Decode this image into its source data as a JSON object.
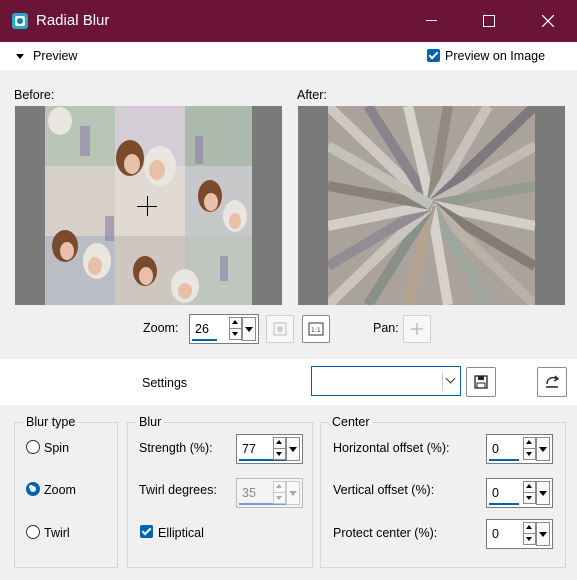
{
  "window": {
    "title": "Radial Blur",
    "icon": "psp-filter-icon",
    "controls": [
      "minimize-icon",
      "maximize-icon",
      "close-icon"
    ],
    "accent_color": "#6b1436"
  },
  "preview": {
    "section_label": "Preview",
    "preview_on_image_label": "Preview on Image",
    "preview_on_image_checked": true,
    "before_label": "Before:",
    "after_label": "After:"
  },
  "zoom": {
    "label": "Zoom:",
    "value": "26",
    "pan_label": "Pan:"
  },
  "settings": {
    "label": "Settings",
    "preset_value": ""
  },
  "blur_type": {
    "title": "Blur type",
    "options": [
      {
        "label": "Spin",
        "selected": false
      },
      {
        "label": "Zoom",
        "selected": true
      },
      {
        "label": "Twirl",
        "selected": false
      }
    ]
  },
  "blur": {
    "title": "Blur",
    "strength_label": "Strength (%):",
    "strength_value": "77",
    "twirl_label": "Twirl degrees:",
    "twirl_value": "35",
    "elliptical_label": "Elliptical",
    "elliptical_checked": true
  },
  "center": {
    "title": "Center",
    "horizontal_label": "Horizontal offset (%):",
    "horizontal_value": "0",
    "vertical_label": "Vertical offset (%):",
    "vertical_value": "0",
    "protect_label": "Protect center (%):",
    "protect_value": "0"
  }
}
